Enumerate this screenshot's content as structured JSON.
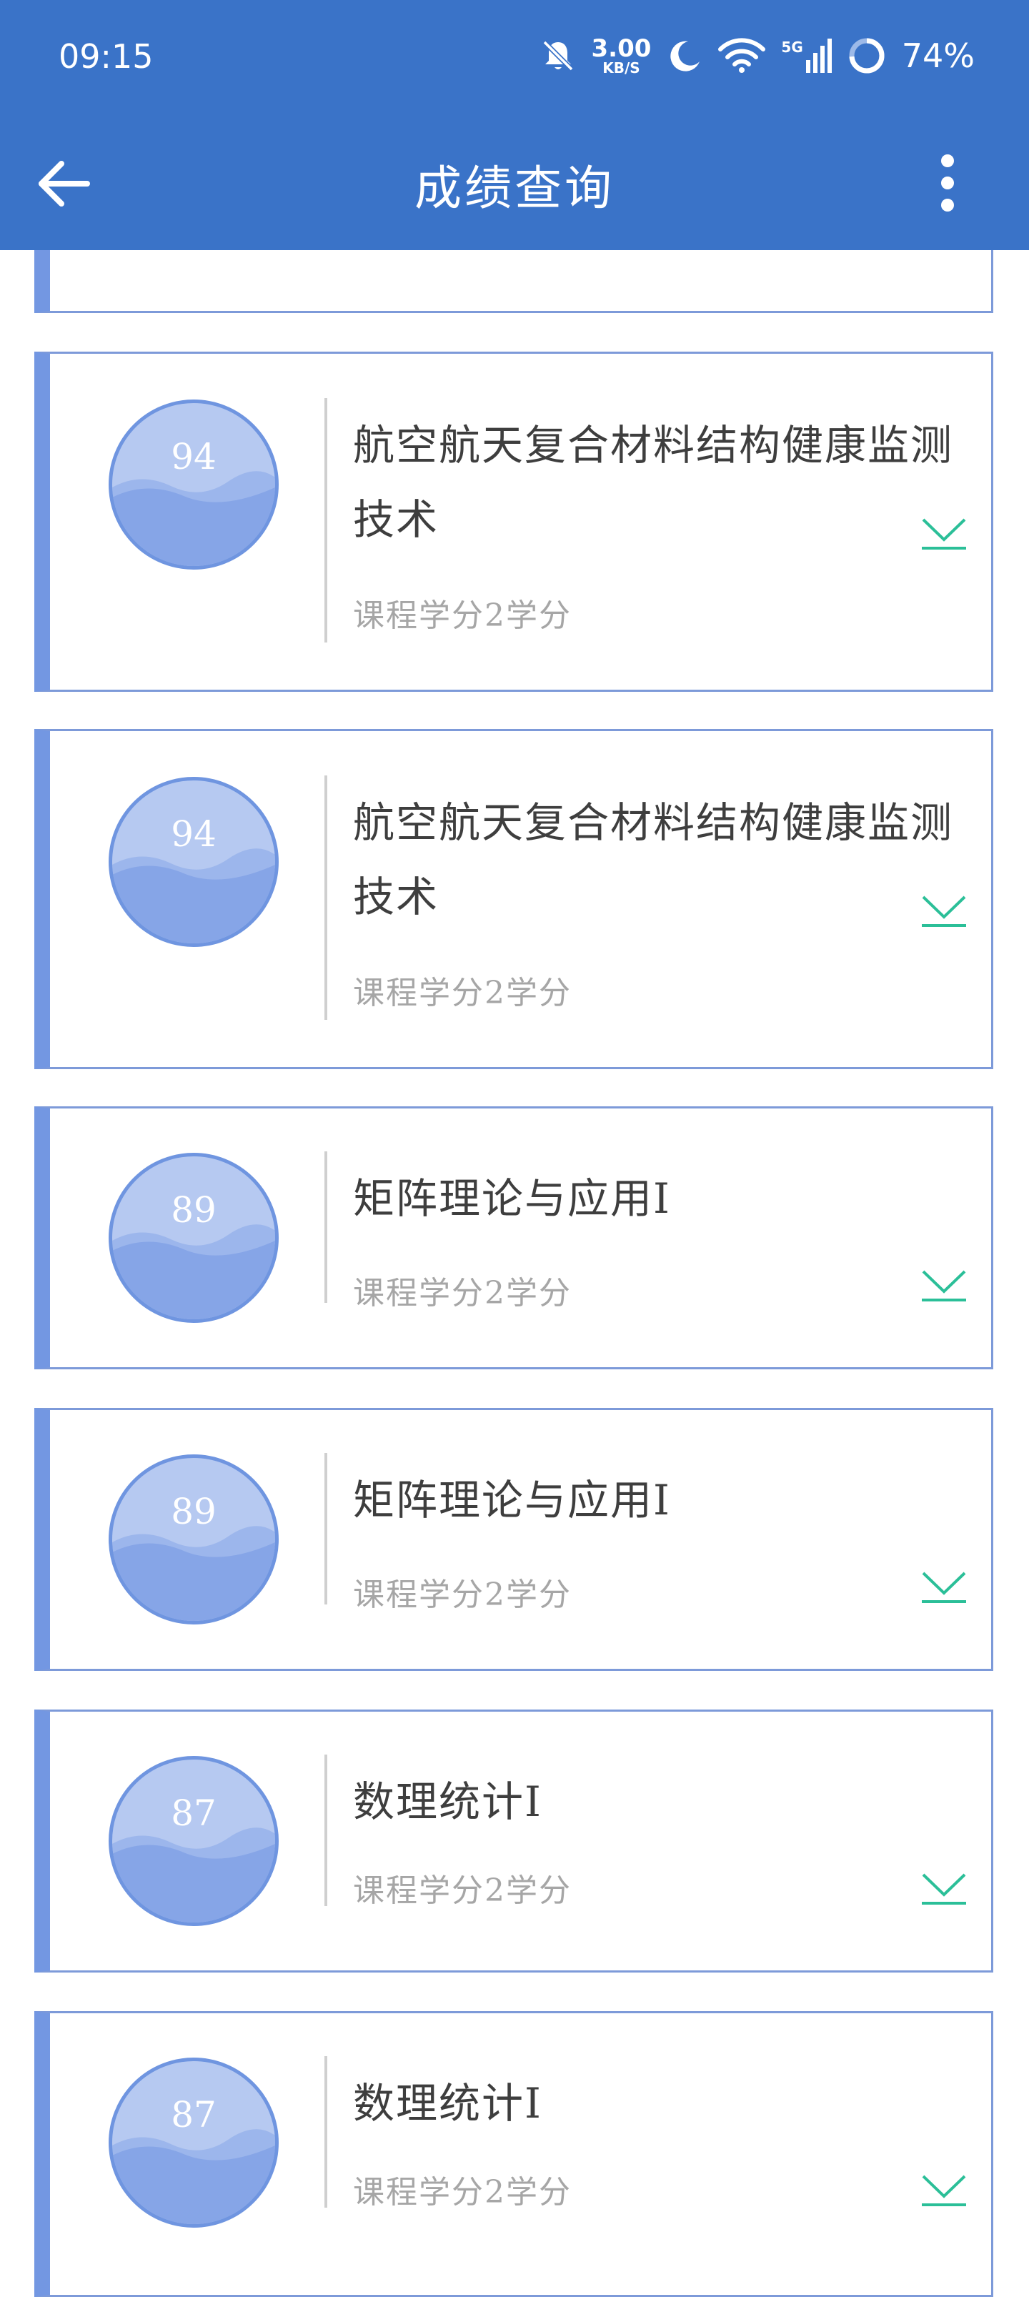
{
  "status_bar": {
    "time": "09:15",
    "net_speed_value": "3.00",
    "net_speed_unit": "KB/S",
    "network_type": "5G",
    "battery": "74%"
  },
  "app_bar": {
    "title": "成绩查询",
    "back_icon": "arrow-left-icon",
    "menu_icon": "more-vertical-icon"
  },
  "colors": {
    "header": "#3a73c8",
    "card_accent": "#7397e2",
    "badge_fill": "#b6c9f1",
    "wave": "#86a5e7",
    "expand_icon": "#2bbf98"
  },
  "courses": [
    {
      "score": "94",
      "name": "航空航天复合材料结构健康监测技术",
      "credit": "课程学分2学分"
    },
    {
      "score": "94",
      "name": "航空航天复合材料结构健康监测技术",
      "credit": "课程学分2学分"
    },
    {
      "score": "89",
      "name": "矩阵理论与应用I",
      "credit": "课程学分2学分"
    },
    {
      "score": "89",
      "name": "矩阵理论与应用I",
      "credit": "课程学分2学分"
    },
    {
      "score": "87",
      "name": "数理统计I",
      "credit": "课程学分2学分"
    },
    {
      "score": "87",
      "name": "数理统计I",
      "credit": "课程学分2学分"
    }
  ]
}
